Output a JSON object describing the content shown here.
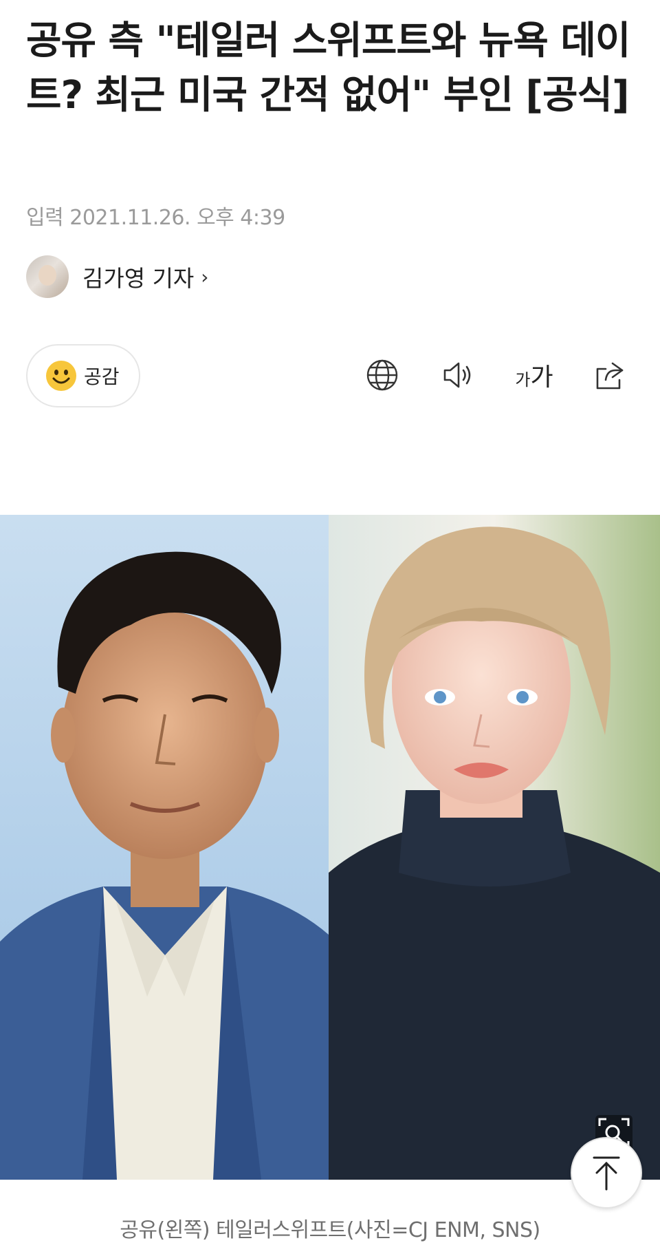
{
  "article": {
    "title": "공유 측 \"테일러 스위프트와 뉴욕 데이트? 최근 미국 간적 없어\" 부인 [공식]",
    "date": "입력 2021.11.26. 오후 4:39",
    "author": "김가영 기자"
  },
  "toolbar": {
    "like_label": "공감",
    "font_small": "가",
    "font_large": "가"
  },
  "photo": {
    "caption": "공유(왼쪽) 테일러스위프트(사진=CJ ENM, SNS)"
  },
  "icons": {
    "author_chevron": "chevron-right-icon",
    "like": "smile-emoji-icon",
    "translate": "globe-icon",
    "listen": "speaker-icon",
    "share": "share-icon",
    "zoom": "magnifier-icon",
    "top": "arrow-up-icon"
  },
  "colors": {
    "title": "#1b1b1b",
    "meta": "#9a9a9a",
    "emoji": "#f7c63b"
  }
}
